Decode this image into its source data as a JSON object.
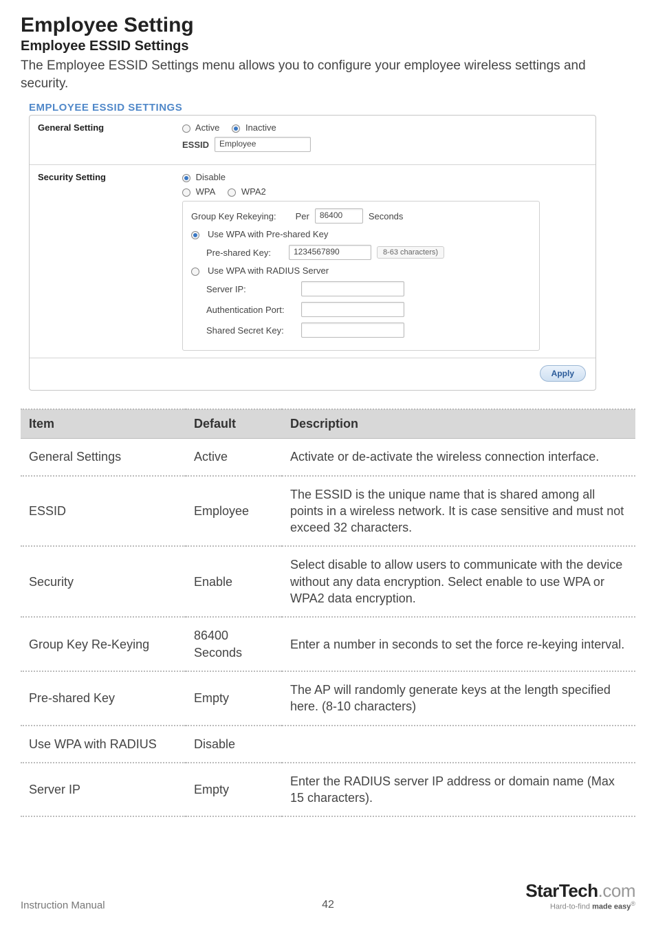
{
  "page": {
    "title": "Employee Setting",
    "subtitle": "Employee ESSID Settings",
    "intro": "The Employee ESSID Settings menu allows you to configure your employee wireless settings and security."
  },
  "panel": {
    "heading": "EMPLOYEE ESSID SETTINGS",
    "general": {
      "label": "General Setting",
      "active_label": "Active",
      "inactive_label": "Inactive",
      "essid_label": "ESSID",
      "essid_value": "Employee"
    },
    "security": {
      "label": "Security Setting",
      "disable_label": "Disable",
      "wpa_label": "WPA",
      "wpa2_label": "WPA2",
      "group_key_label": "Group Key Rekeying:",
      "per_label": "Per",
      "per_value": "86400",
      "seconds_label": "Seconds",
      "use_psk_label": "Use WPA with Pre-shared Key",
      "psk_label": "Pre-shared Key:",
      "psk_value": "1234567890",
      "psk_note": "8-63 characters)",
      "use_radius_label": "Use WPA with RADIUS Server",
      "server_ip_label": "Server IP:",
      "auth_port_label": "Authentication Port:",
      "shared_secret_label": "Shared Secret Key:"
    },
    "apply_label": "Apply"
  },
  "table": {
    "headers": {
      "item": "Item",
      "default": "Default",
      "description": "Description"
    },
    "rows": [
      {
        "item": "General Settings",
        "default": "Active",
        "description": "Activate or de-activate the wireless connection interface."
      },
      {
        "item": "ESSID",
        "default": "Employee",
        "description": "The ESSID is the unique name that is shared among all points in a wireless network. It is case sensitive and must not exceed 32 characters."
      },
      {
        "item": "Security",
        "default": "Enable",
        "description": "Select disable to allow users to communicate with the device without any data encryption. Select enable to use WPA or WPA2 data encryption."
      },
      {
        "item": "Group Key Re-Keying",
        "default": "86400 Seconds",
        "description": "Enter a number in seconds to set the force re-keying interval."
      },
      {
        "item": "Pre-shared Key",
        "default": "Empty",
        "description": "The AP will randomly generate keys at the length specified here. (8-10 characters)"
      },
      {
        "item": "Use WPA with RADIUS",
        "default": "Disable",
        "description": ""
      },
      {
        "item": "Server IP",
        "default": "Empty",
        "description": "Enter the RADIUS server IP address or domain name (Max 15 characters)."
      }
    ]
  },
  "footer": {
    "manual": "Instruction Manual",
    "page_number": "42",
    "brand_main_a": "StarTech",
    "brand_main_b": ".com",
    "brand_tag_a": "Hard-to-find ",
    "brand_tag_b": "made easy",
    "brand_tag_reg": "®"
  }
}
